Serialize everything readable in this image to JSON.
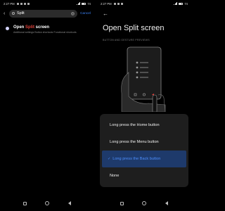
{
  "left": {
    "status": {
      "time": "2:27 PM",
      "battery": "74"
    },
    "search": {
      "query": "Split",
      "cancel_label": "Cancel"
    },
    "result": {
      "title_before": "Open ",
      "title_highlight": "Split",
      "title_after": " screen",
      "description": "Additional settings·Button shortcuts·Functional shortcuts"
    }
  },
  "right": {
    "status": {
      "time": "2:27 PM",
      "battery": "74"
    },
    "title": "Open Split screen",
    "section_label": "BUTTON AND GESTURE PREVIEWS",
    "options": [
      {
        "label": "Long press the Home button",
        "selected": false
      },
      {
        "label": "Long press the Menu button",
        "selected": false
      },
      {
        "label": "Long press the Back button",
        "selected": true
      },
      {
        "label": "None",
        "selected": false
      }
    ],
    "battery_level": 0.74
  },
  "colors": {
    "accent": "#4d8fff",
    "highlight": "#e0403a",
    "selected_bg": "#1e3a6b",
    "panel_bg": "#1e1e1e"
  },
  "icons": [
    "back-arrow-icon",
    "search-icon",
    "clear-icon",
    "wifi-icon",
    "battery-icon",
    "signal-icon",
    "nav-recents-icon",
    "nav-home-icon",
    "nav-back-icon",
    "check-icon"
  ]
}
